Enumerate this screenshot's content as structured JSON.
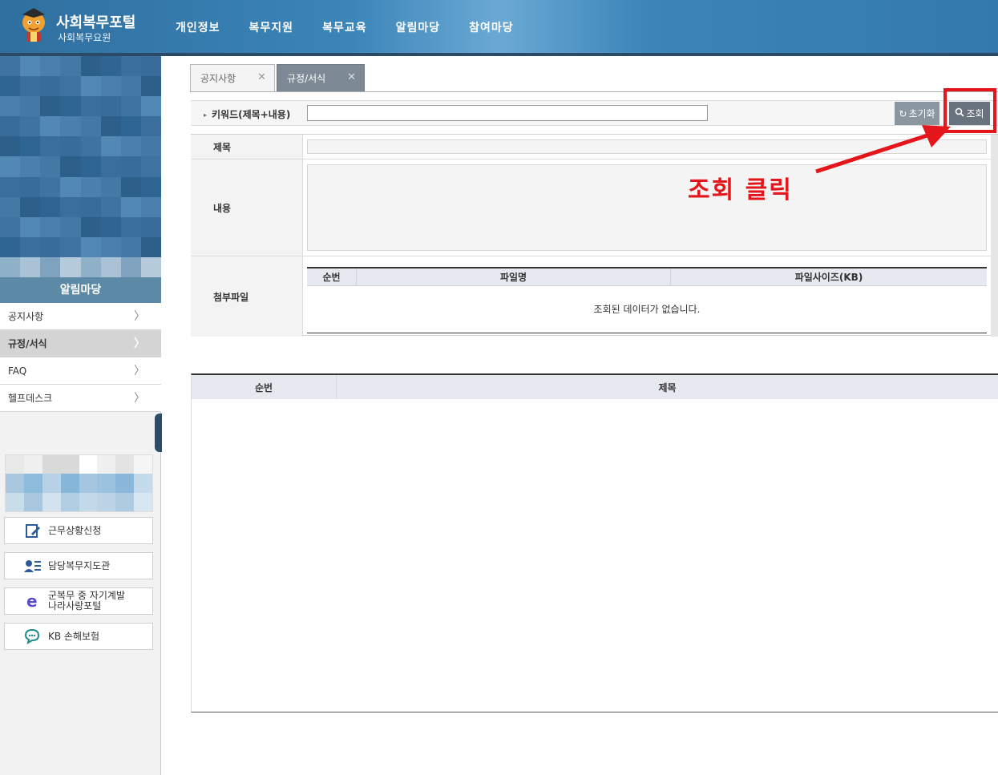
{
  "header": {
    "title": "사회복무포털",
    "subtitle": "사회복무요원",
    "nav": [
      "개인정보",
      "복무지원",
      "복무교육",
      "알림마당",
      "참여마당"
    ]
  },
  "sidebar": {
    "section_title": "알림마당",
    "items": [
      {
        "label": "공지사항",
        "active": false
      },
      {
        "label": "규정/서식",
        "active": true
      },
      {
        "label": "FAQ",
        "active": false
      },
      {
        "label": "헬프데스크",
        "active": false
      }
    ],
    "quick_links": [
      {
        "label": "근무상황신청",
        "icon": "edit-form-icon"
      },
      {
        "label": "담당복무지도관",
        "icon": "person-card-icon"
      },
      {
        "label": "군복무 중 자기계발",
        "label2": "나라사랑포털",
        "icon": "e-letter-icon"
      },
      {
        "label": "KB 손해보험",
        "icon": "chat-bubble-icon"
      }
    ]
  },
  "tabs": [
    {
      "label": "공지사항",
      "active": false
    },
    {
      "label": "규정/서식",
      "active": true
    }
  ],
  "search": {
    "label": "키워드(제목+내용)",
    "value": "",
    "reset_label": "초기화",
    "search_label": "조회"
  },
  "detail": {
    "title_label": "제목",
    "content_label": "내용",
    "attachment_label": "첨부파일",
    "file_columns": [
      "순번",
      "파일명",
      "파일사이즈(KB)"
    ],
    "empty_message": "조회된 데이터가 없습니다."
  },
  "list": {
    "columns": [
      "순번",
      "제목"
    ]
  },
  "annotation": {
    "text": "조회 클릭",
    "color": "#e4161b"
  }
}
